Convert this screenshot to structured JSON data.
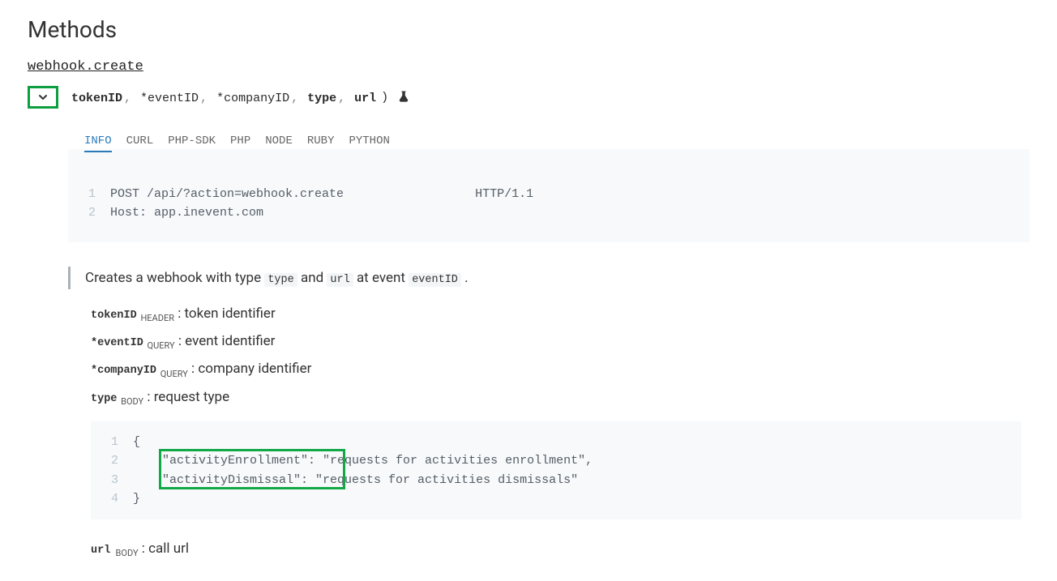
{
  "title": "Methods",
  "method_name": "webhook.create",
  "signature": {
    "parts": [
      {
        "text": "tokenID",
        "bold": true
      },
      {
        "text": "*eventID",
        "bold": false
      },
      {
        "text": "*companyID",
        "bold": false
      },
      {
        "text": "type",
        "bold": true
      },
      {
        "text": "url",
        "bold": true
      }
    ],
    "closing": " )"
  },
  "tabs": [
    "INFO",
    "CURL",
    "PHP-SDK",
    "PHP",
    "NODE",
    "RUBY",
    "PYTHON"
  ],
  "active_tab": "INFO",
  "http_snippet": [
    "POST /api/?action=webhook.create                  HTTP/1.1",
    "Host: app.inevent.com"
  ],
  "description": {
    "prefix": "Creates a webhook with type ",
    "code1": "type",
    "middle": " and ",
    "code2": "url",
    "after": " at event ",
    "code3": "eventID",
    "suffix": "."
  },
  "params": [
    {
      "name": "tokenID",
      "loc": "HEADER",
      "desc": "token identifier"
    },
    {
      "name": "*eventID",
      "loc": "QUERY",
      "desc": "event identifier"
    },
    {
      "name": "*companyID",
      "loc": "QUERY",
      "desc": "company identifier"
    },
    {
      "name": "type",
      "loc": "BODY",
      "desc": "request type"
    }
  ],
  "json_snippet": [
    "{",
    "    \"activityEnrollment\": \"requests for activities enrollment\",",
    "    \"activityDismissal\": \"requests for activities dismissals\"",
    "}"
  ],
  "param_url": {
    "name": "url",
    "loc": "BODY",
    "desc": "call url"
  }
}
